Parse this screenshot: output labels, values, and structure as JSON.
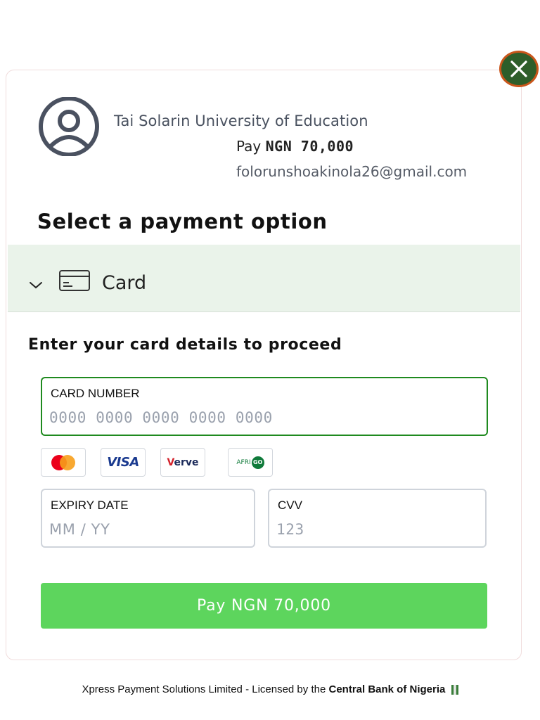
{
  "merchant": {
    "name": "Tai Solarin University of Education",
    "pay_prefix": "Pay",
    "amount": "NGN 70,000",
    "email": "folorunshoakinola26@gmail.com"
  },
  "section_title": "Select a payment option",
  "payment_option": {
    "label": "Card",
    "icon": "credit-card-icon",
    "expanded": true
  },
  "card_form": {
    "title": "Enter your card details to proceed",
    "card_number": {
      "label": "CARD NUMBER",
      "placeholder": "0000 0000 0000 0000 0000"
    },
    "expiry": {
      "label": "EXPIRY DATE",
      "placeholder": "MM / YY"
    },
    "cvv": {
      "label": "CVV",
      "placeholder": "123"
    },
    "brands": [
      "mastercard",
      "VISA",
      "Verve",
      "AFRIGO"
    ],
    "pay_button": "Pay NGN 70,000"
  },
  "footer": {
    "text": "Xpress Payment Solutions Limited - Licensed by the",
    "bold": "Central Bank of Nigeria"
  },
  "colors": {
    "accent_green": "#5dd55d",
    "field_focus": "#1f8a1f",
    "option_bg": "#eaf3ea",
    "close_bg": "#2e5e2a",
    "close_border": "#c9561b"
  }
}
